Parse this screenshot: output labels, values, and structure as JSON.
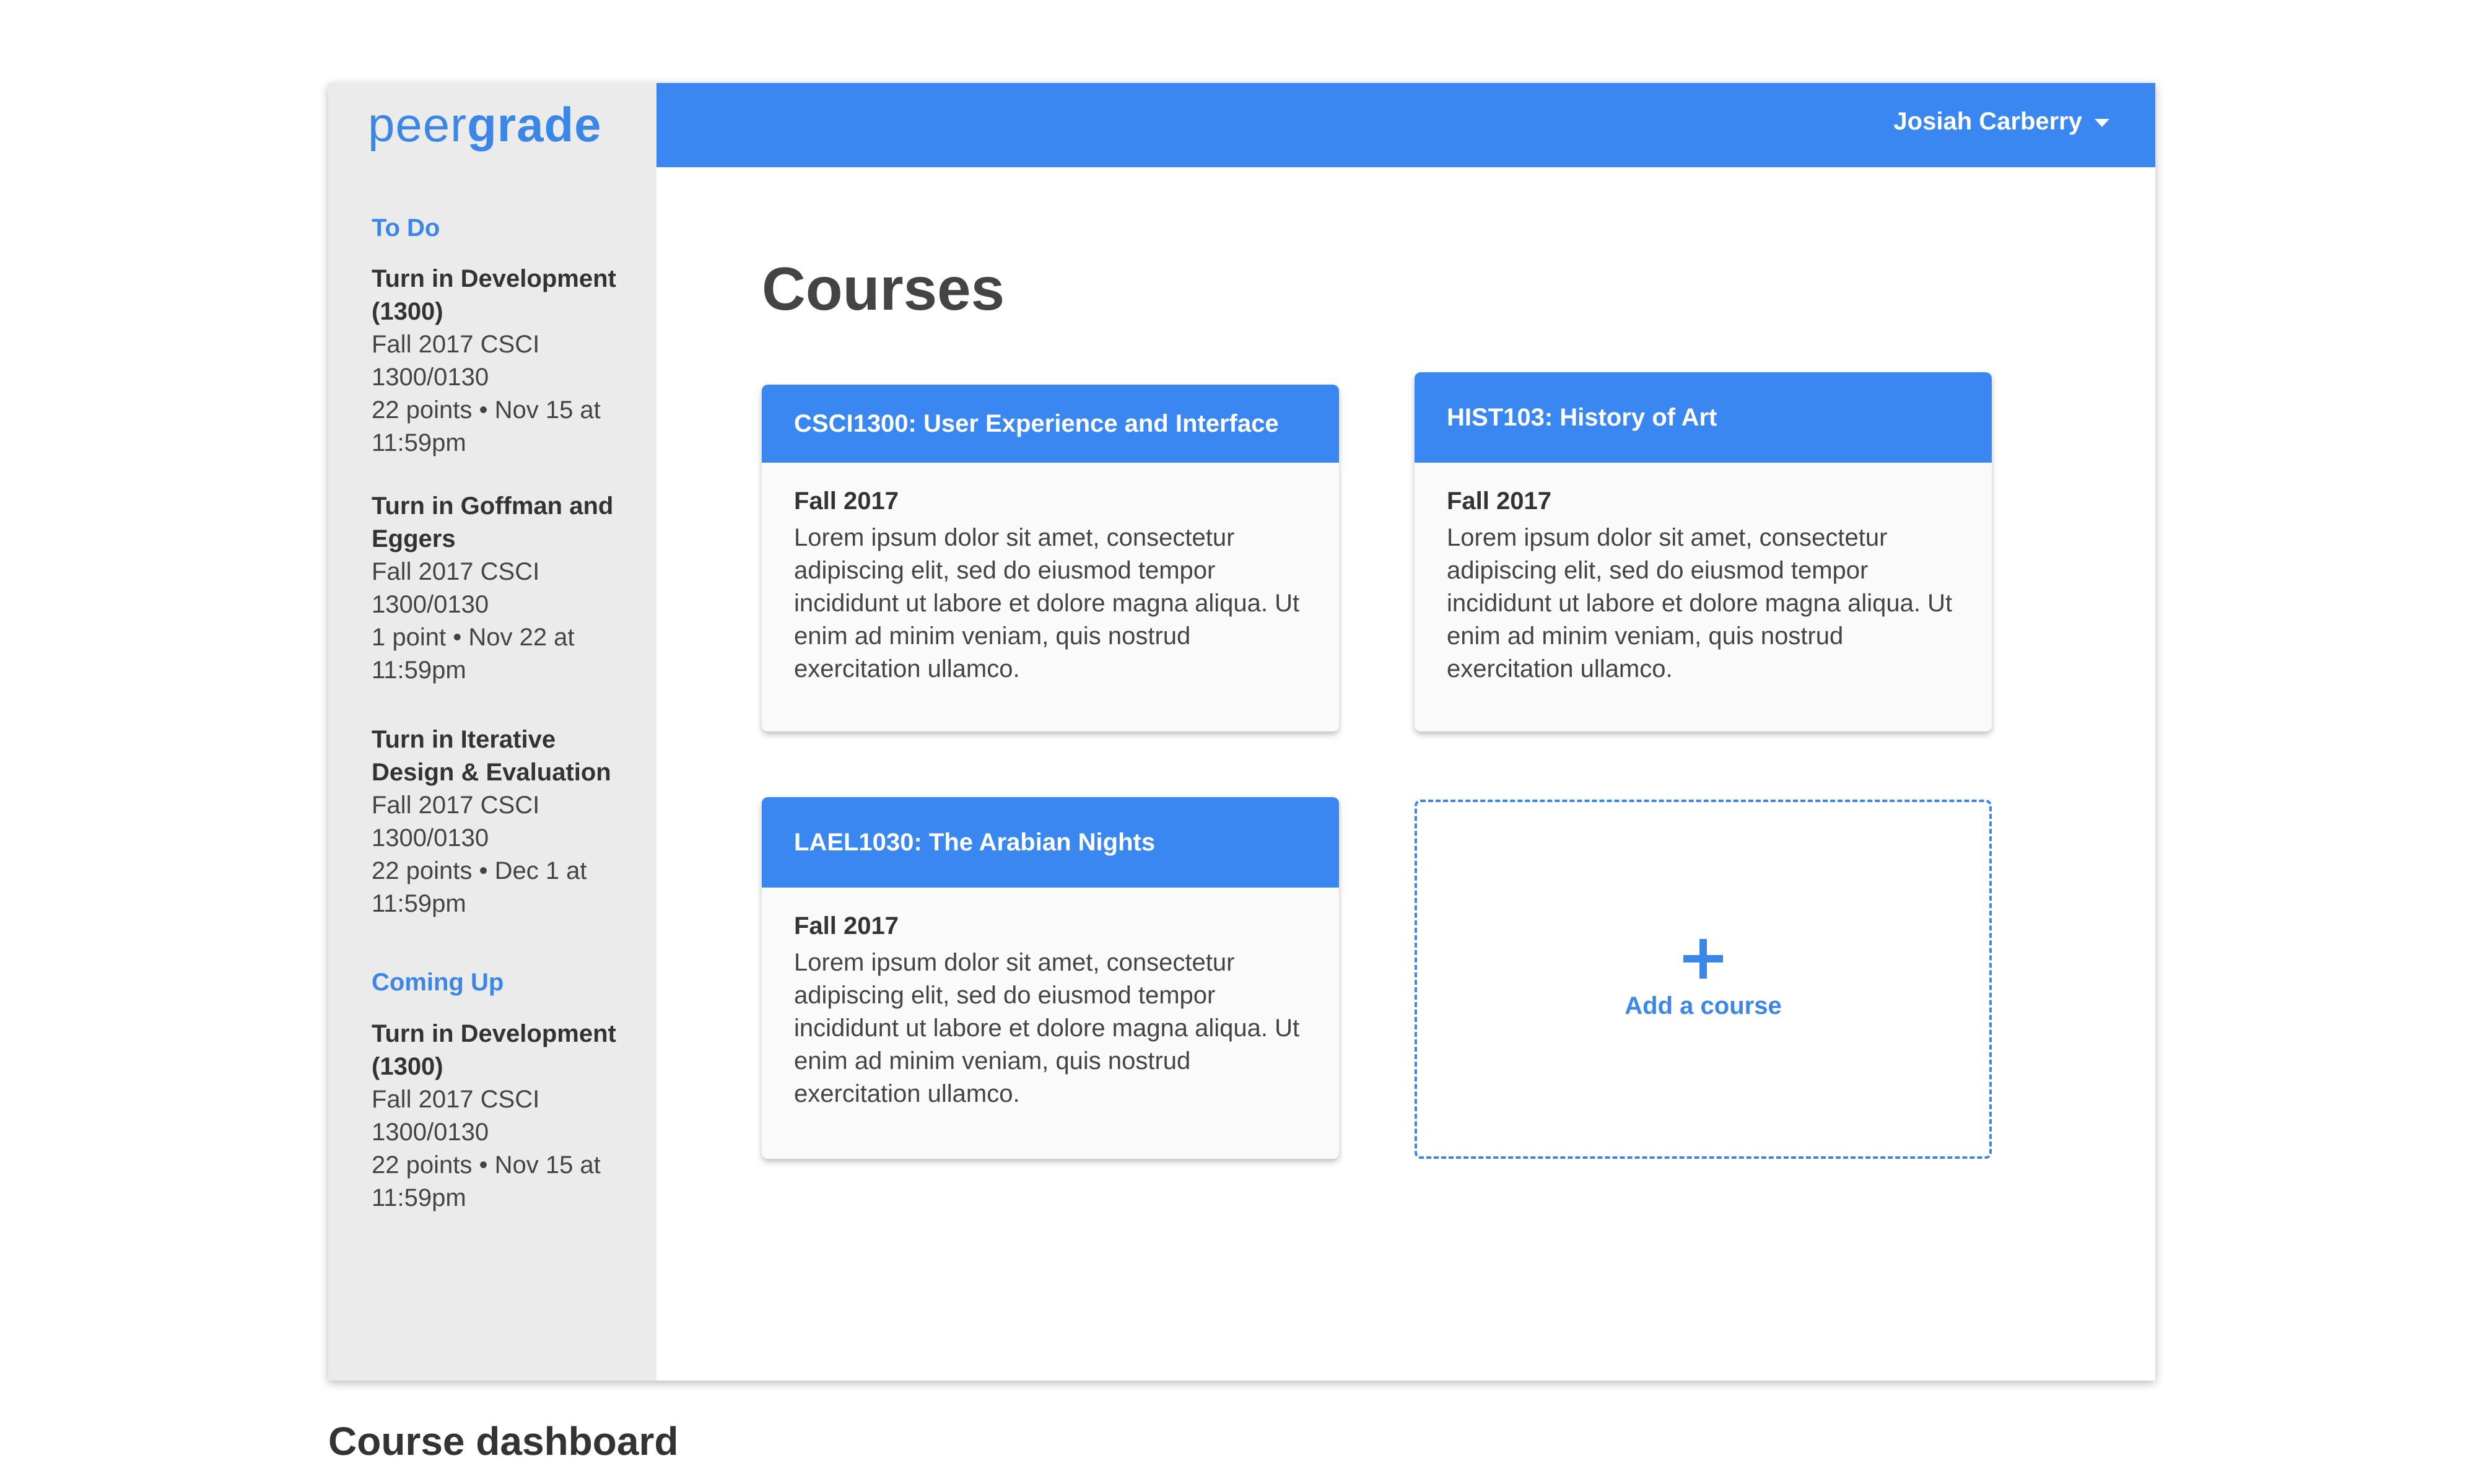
{
  "app": {
    "logo_light": "peer",
    "logo_bold": "grade"
  },
  "header": {
    "user_name": "Josiah Carberry"
  },
  "sidebar": {
    "todo_label": "To Do",
    "todo_items": [
      {
        "title": "Turn in Development (1300)",
        "course": "Fall 2017 CSCI 1300/0130",
        "detail": "22 points • Nov 15 at 11:59pm"
      },
      {
        "title": "Turn in Goffman and Eggers",
        "course": "Fall 2017 CSCI 1300/0130",
        "detail": "1 point • Nov 22 at 11:59pm"
      },
      {
        "title": "Turn in Iterative Design & Evaluation",
        "course": "Fall 2017 CSCI 1300/0130",
        "detail": "22 points • Dec 1 at 11:59pm"
      }
    ],
    "upcoming_label": "Coming Up",
    "upcoming_items": [
      {
        "title": "Turn in Development (1300)",
        "course": "Fall 2017 CSCI 1300/0130",
        "detail": "22 points • Nov 15 at 11:59pm"
      }
    ]
  },
  "main": {
    "title": "Courses",
    "courses": [
      {
        "name": "CSCI1300: User Experience and Interface",
        "term": "Fall 2017",
        "description": "Lorem ipsum dolor sit amet, consectetur adipiscing elit, sed do eiusmod tempor incididunt ut labore et dolore magna aliqua. Ut enim ad minim veniam, quis nostrud exercitation ullamco."
      },
      {
        "name": "HIST103: History of Art",
        "term": "Fall 2017",
        "description": "Lorem ipsum dolor sit amet, consectetur adipiscing elit, sed do eiusmod tempor incididunt ut labore et dolore magna aliqua. Ut enim ad minim veniam, quis nostrud exercitation ullamco."
      },
      {
        "name": "LAEL1030: The Arabian Nights",
        "term": "Fall 2017",
        "description": "Lorem ipsum dolor sit amet, consectetur adipiscing elit, sed do eiusmod tempor incididunt ut labore et dolore magna aliqua. Ut enim ad minim veniam, quis nostrud exercitation ullamco."
      }
    ],
    "add_course_label": "Add a course"
  },
  "caption": "Course dashboard",
  "colors": {
    "accent": "#3b87f2",
    "sidebar_bg": "#ebebeb",
    "text": "#444444"
  }
}
